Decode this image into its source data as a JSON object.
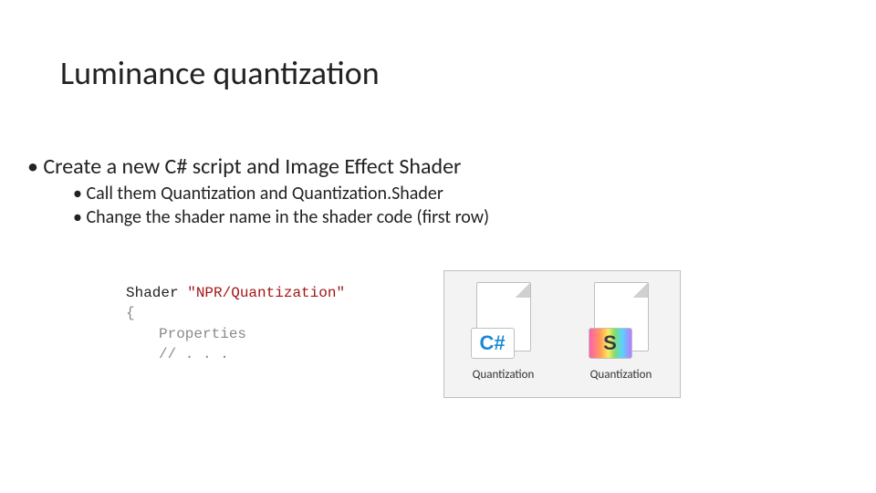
{
  "title": "Luminance quantization",
  "bullets": {
    "main": "• Create a new C# script and Image Effect Shader",
    "sub1": "• Call them Quantization and Quantization.Shader",
    "sub2": "• Change the shader name in the shader code (first row)"
  },
  "code": {
    "keyword": "Shader",
    "string": "\"NPR/Quantization\"",
    "brace": "{",
    "line_props": "Properties",
    "line_etc": "// . . ."
  },
  "files": {
    "csharp_glyph": "C#",
    "shader_glyph": "S",
    "label1": "Quantization",
    "label2": "Quantization"
  }
}
